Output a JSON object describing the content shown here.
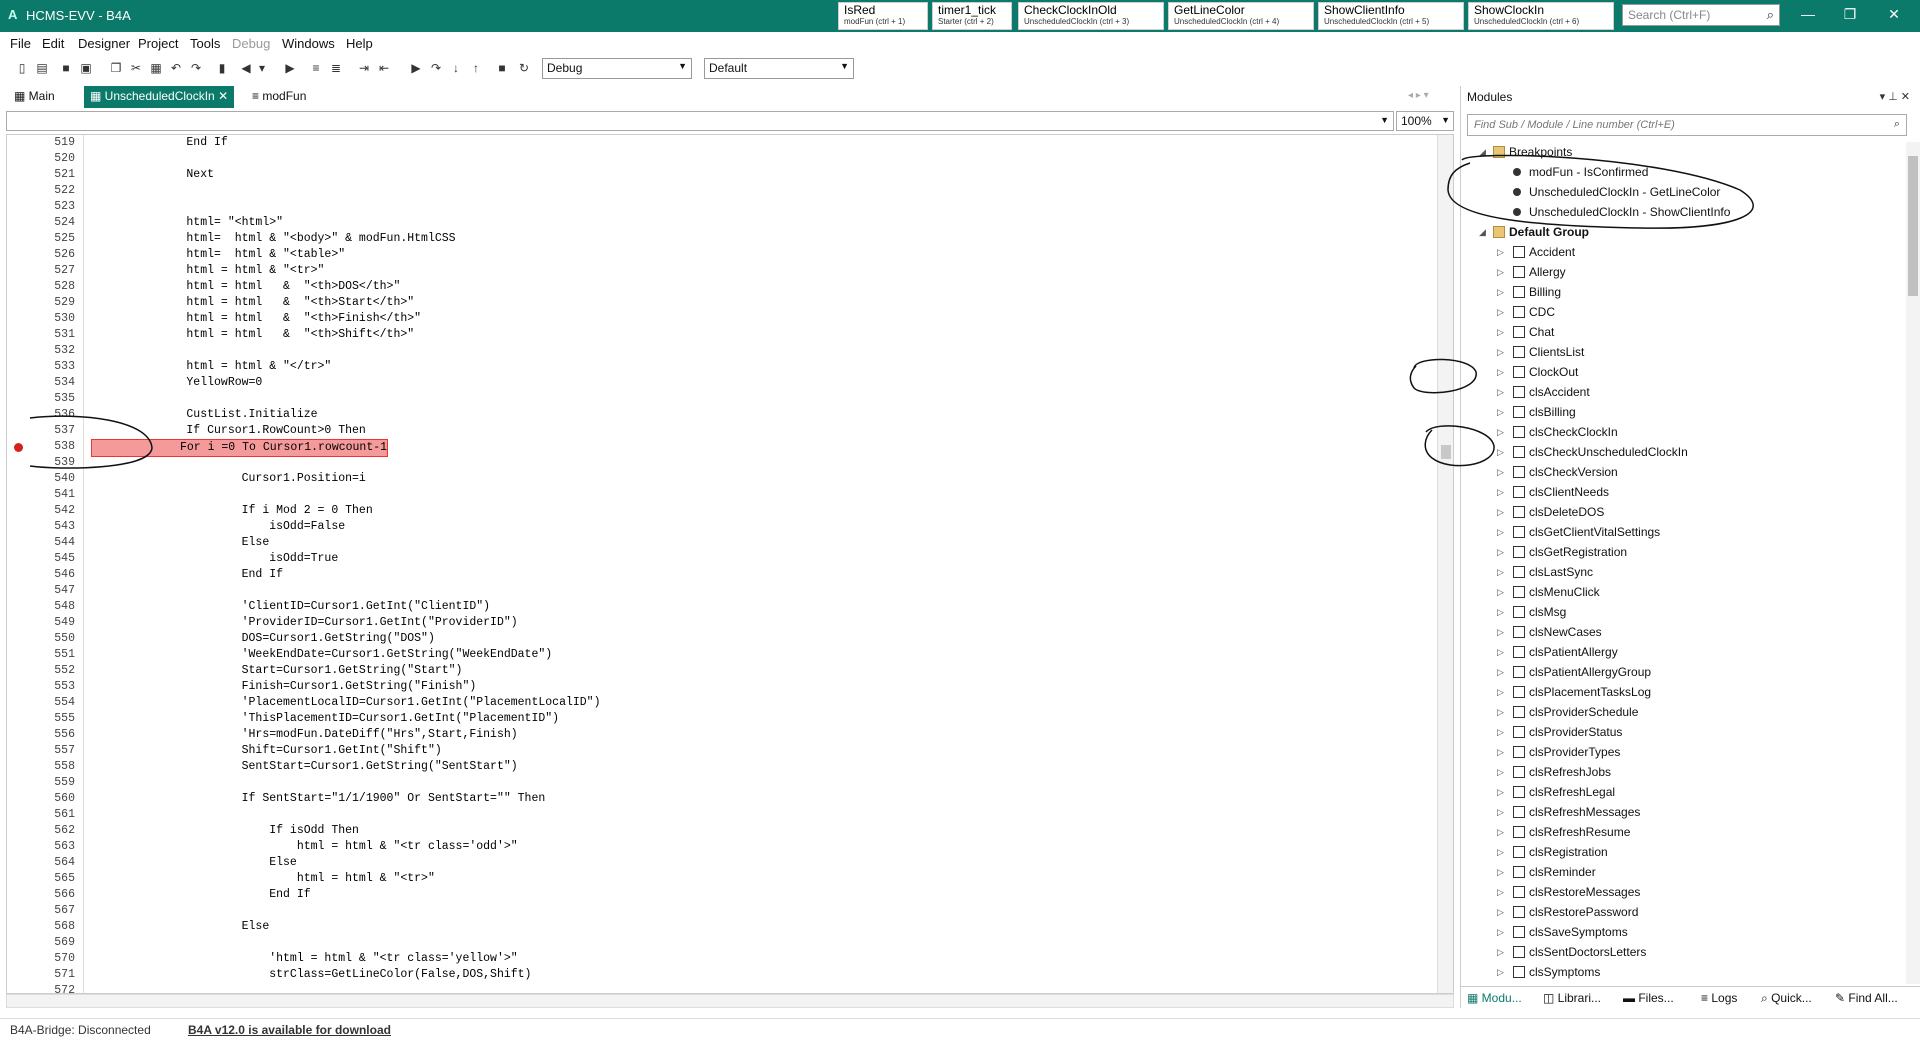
{
  "app": {
    "title": "HCMS-EVV - B4A",
    "logo": "A"
  },
  "quick_tabs": [
    {
      "name": "IsRed",
      "sub": "modFun  (ctrl + 1)"
    },
    {
      "name": "timer1_tick",
      "sub": "Starter  (ctrl + 2)"
    },
    {
      "name": "CheckClockInOld",
      "sub": "UnscheduledClockIn  (ctrl + 3)"
    },
    {
      "name": "GetLineColor",
      "sub": "UnscheduledClockIn  (ctrl + 4)"
    },
    {
      "name": "ShowClientInfo",
      "sub": "UnscheduledClockIn  (ctrl + 5)"
    },
    {
      "name": "ShowClockIn",
      "sub": "UnscheduledClockIn  (ctrl + 6)"
    }
  ],
  "search": {
    "placeholder": "Search (Ctrl+F)"
  },
  "menu": [
    "File",
    "Edit",
    "Designer",
    "Project",
    "Tools",
    "Debug",
    "Windows",
    "Help"
  ],
  "toolbar": {
    "build_config": "Debug",
    "package_config": "Default"
  },
  "doc_tabs": [
    "Main",
    "UnscheduledClockIn",
    "modFun"
  ],
  "zoom": "100%",
  "code_lines": [
    {
      "n": "519",
      "t": "      End If"
    },
    {
      "n": "520",
      "t": ""
    },
    {
      "n": "521",
      "t": "      Next"
    },
    {
      "n": "522",
      "t": ""
    },
    {
      "n": "523",
      "t": ""
    },
    {
      "n": "524",
      "t": "      html= \"<html>\""
    },
    {
      "n": "525",
      "t": "      html=  html & \"<body>\" & modFun.HtmlCSS"
    },
    {
      "n": "526",
      "t": "      html=  html & \"<table>\""
    },
    {
      "n": "527",
      "t": "      html = html & \"<tr>\""
    },
    {
      "n": "528",
      "t": "      html = html   &  \"<th>DOS</th>\""
    },
    {
      "n": "529",
      "t": "      html = html   &  \"<th>Start</th>\""
    },
    {
      "n": "530",
      "t": "      html = html   &  \"<th>Finish</th>\""
    },
    {
      "n": "531",
      "t": "      html = html   &  \"<th>Shift</th>\""
    },
    {
      "n": "532",
      "t": ""
    },
    {
      "n": "533",
      "t": "      html = html & \"</tr>\""
    },
    {
      "n": "534",
      "t": "      YellowRow=0"
    },
    {
      "n": "535",
      "t": ""
    },
    {
      "n": "536",
      "t": "      CustList.Initialize"
    },
    {
      "n": "537",
      "t": "      If Cursor1.RowCount>0 Then"
    },
    {
      "n": "538",
      "t": "For i =0 To Cursor1.rowcount-1",
      "bp": true
    },
    {
      "n": "539",
      "t": ""
    },
    {
      "n": "540",
      "t": "              Cursor1.Position=i"
    },
    {
      "n": "541",
      "t": ""
    },
    {
      "n": "542",
      "t": "              If i Mod 2 = 0 Then"
    },
    {
      "n": "543",
      "t": "                  isOdd=False"
    },
    {
      "n": "544",
      "t": "              Else"
    },
    {
      "n": "545",
      "t": "                  isOdd=True"
    },
    {
      "n": "546",
      "t": "              End If"
    },
    {
      "n": "547",
      "t": ""
    },
    {
      "n": "548",
      "t": "              'ClientID=Cursor1.GetInt(\"ClientID\")"
    },
    {
      "n": "549",
      "t": "              'ProviderID=Cursor1.GetInt(\"ProviderID\")"
    },
    {
      "n": "550",
      "t": "              DOS=Cursor1.GetString(\"DOS\")"
    },
    {
      "n": "551",
      "t": "              'WeekEndDate=Cursor1.GetString(\"WeekEndDate\")"
    },
    {
      "n": "552",
      "t": "              Start=Cursor1.GetString(\"Start\")"
    },
    {
      "n": "553",
      "t": "              Finish=Cursor1.GetString(\"Finish\")"
    },
    {
      "n": "554",
      "t": "              'PlacementLocalID=Cursor1.GetInt(\"PlacementLocalID\")"
    },
    {
      "n": "555",
      "t": "              'ThisPlacementID=Cursor1.GetInt(\"PlacementID\")"
    },
    {
      "n": "556",
      "t": "              'Hrs=modFun.DateDiff(\"Hrs\",Start,Finish)"
    },
    {
      "n": "557",
      "t": "              Shift=Cursor1.GetInt(\"Shift\")"
    },
    {
      "n": "558",
      "t": "              SentStart=Cursor1.GetString(\"SentStart\")"
    },
    {
      "n": "559",
      "t": ""
    },
    {
      "n": "560",
      "t": "              If SentStart=\"1/1/1900\" Or SentStart=\"\" Then"
    },
    {
      "n": "561",
      "t": ""
    },
    {
      "n": "562",
      "t": "                  If isOdd Then"
    },
    {
      "n": "563",
      "t": "                      html = html & \"<tr class='odd'>\""
    },
    {
      "n": "564",
      "t": "                  Else"
    },
    {
      "n": "565",
      "t": "                      html = html & \"<tr>\""
    },
    {
      "n": "566",
      "t": "                  End If"
    },
    {
      "n": "567",
      "t": ""
    },
    {
      "n": "568",
      "t": "              Else"
    },
    {
      "n": "569",
      "t": ""
    },
    {
      "n": "570",
      "t": "                  'html = html & \"<tr class='yellow'>\""
    },
    {
      "n": "571",
      "t": "                  strClass=GetLineColor(False,DOS,Shift)"
    },
    {
      "n": "572",
      "t": ""
    }
  ],
  "modules_panel": {
    "title": "Modules",
    "search_placeholder": "Find Sub / Module / Line number (Ctrl+E)",
    "breakpoints_label": "Breakpoints",
    "breakpoints": [
      "modFun - IsConfirmed",
      "UnscheduledClockIn - GetLineColor",
      "UnscheduledClockIn - ShowClientInfo"
    ],
    "default_group_label": "Default Group",
    "modules": [
      "Accident",
      "Allergy",
      "Billing",
      "CDC",
      "Chat",
      "ClientsList",
      "ClockOut",
      "clsAccident",
      "clsBilling",
      "clsCheckClockIn",
      "clsCheckUnscheduledClockIn",
      "clsCheckVersion",
      "clsClientNeeds",
      "clsDeleteDOS",
      "clsGetClientVitalSettings",
      "clsGetRegistration",
      "clsLastSync",
      "clsMenuClick",
      "clsMsg",
      "clsNewCases",
      "clsPatientAllergy",
      "clsPatientAllergyGroup",
      "clsPlacementTasksLog",
      "clsProviderSchedule",
      "clsProviderStatus",
      "clsProviderTypes",
      "clsRefreshJobs",
      "clsRefreshLegal",
      "clsRefreshMessages",
      "clsRefreshResume",
      "clsRegistration",
      "clsReminder",
      "clsRestoreMessages",
      "clsRestorePassword",
      "clsSaveSymptoms",
      "clsSentDoctorsLetters",
      "clsSymptoms"
    ],
    "bottom_tabs": [
      "Modu...",
      "Librari...",
      "Files...",
      "Logs",
      "Quick...",
      "Find All..."
    ]
  },
  "status": {
    "bridge": "B4A-Bridge: Disconnected",
    "update_link": "B4A v12.0 is available for download"
  }
}
